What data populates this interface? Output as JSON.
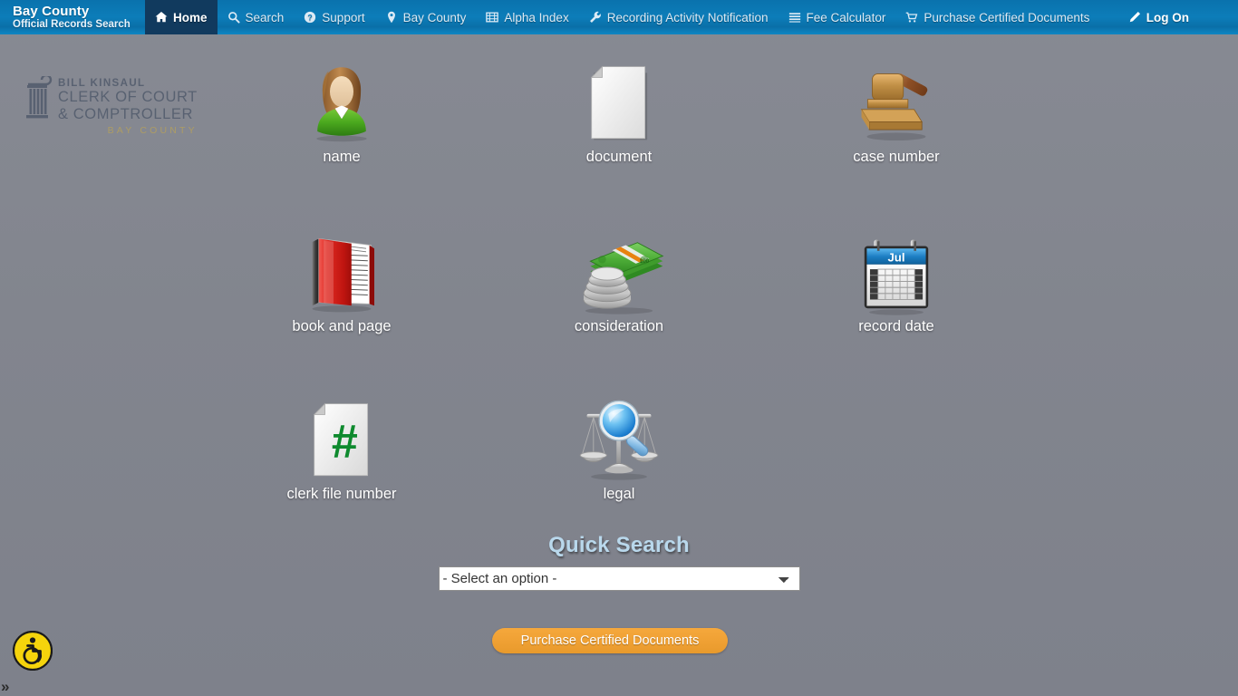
{
  "nav": {
    "brand": {
      "line1": "Bay County",
      "line2_bold": "Official Records",
      "line2_light": " Search"
    },
    "items": [
      {
        "label": "Home",
        "icon": "home-icon",
        "active": true
      },
      {
        "label": "Search",
        "icon": "search-icon",
        "active": false
      },
      {
        "label": "Support",
        "icon": "help-circle-icon",
        "active": false
      },
      {
        "label": "Bay County",
        "icon": "map-pin-icon",
        "active": false
      },
      {
        "label": "Alpha Index",
        "icon": "grid-table-icon",
        "active": false
      },
      {
        "label": "Recording Activity Notification",
        "icon": "wrench-icon",
        "active": false
      },
      {
        "label": "Fee Calculator",
        "icon": "list-lines-icon",
        "active": false
      },
      {
        "label": "Purchase Certified Documents",
        "icon": "shopping-cart-icon",
        "active": false
      }
    ],
    "log_on": {
      "label": "Log On",
      "icon": "pencil-icon"
    }
  },
  "logo": {
    "name": "BILL KINSAUL",
    "title_line1": "CLERK OF COURT",
    "title_line2": "& COMPTROLLER",
    "county": "BAY COUNTY",
    "mark": "column-pillar-icon"
  },
  "tiles": [
    [
      {
        "label": "name",
        "icon": "person-avatar-icon"
      },
      {
        "label": "document",
        "icon": "document-page-icon"
      },
      {
        "label": "case number",
        "icon": "gavel-icon"
      }
    ],
    [
      {
        "label": "book and page",
        "icon": "red-book-icon"
      },
      {
        "label": "consideration",
        "icon": "money-coins-icon"
      },
      {
        "label": "record date",
        "icon": "calendar-icon"
      }
    ],
    [
      {
        "label": "clerk file number",
        "icon": "document-hash-icon"
      },
      {
        "label": "legal",
        "icon": "scales-magnifier-icon"
      }
    ]
  ],
  "calendar_month": "Jul",
  "quick_search": {
    "title": "Quick Search",
    "selected_option": "- Select an option -"
  },
  "purchase_button": {
    "label": "Purchase Certified Documents"
  },
  "accessibility": {
    "widget_icon": "wheelchair-accessibility-icon",
    "expand_chevron": "»"
  },
  "colors": {
    "nav_blue": "#0c7db9",
    "nav_active": "#113a5e",
    "page_gray": "#83868f",
    "accent_orange": "#efa033",
    "title_blue": "#b9d8ec",
    "a11y_yellow": "#f5d40c"
  }
}
